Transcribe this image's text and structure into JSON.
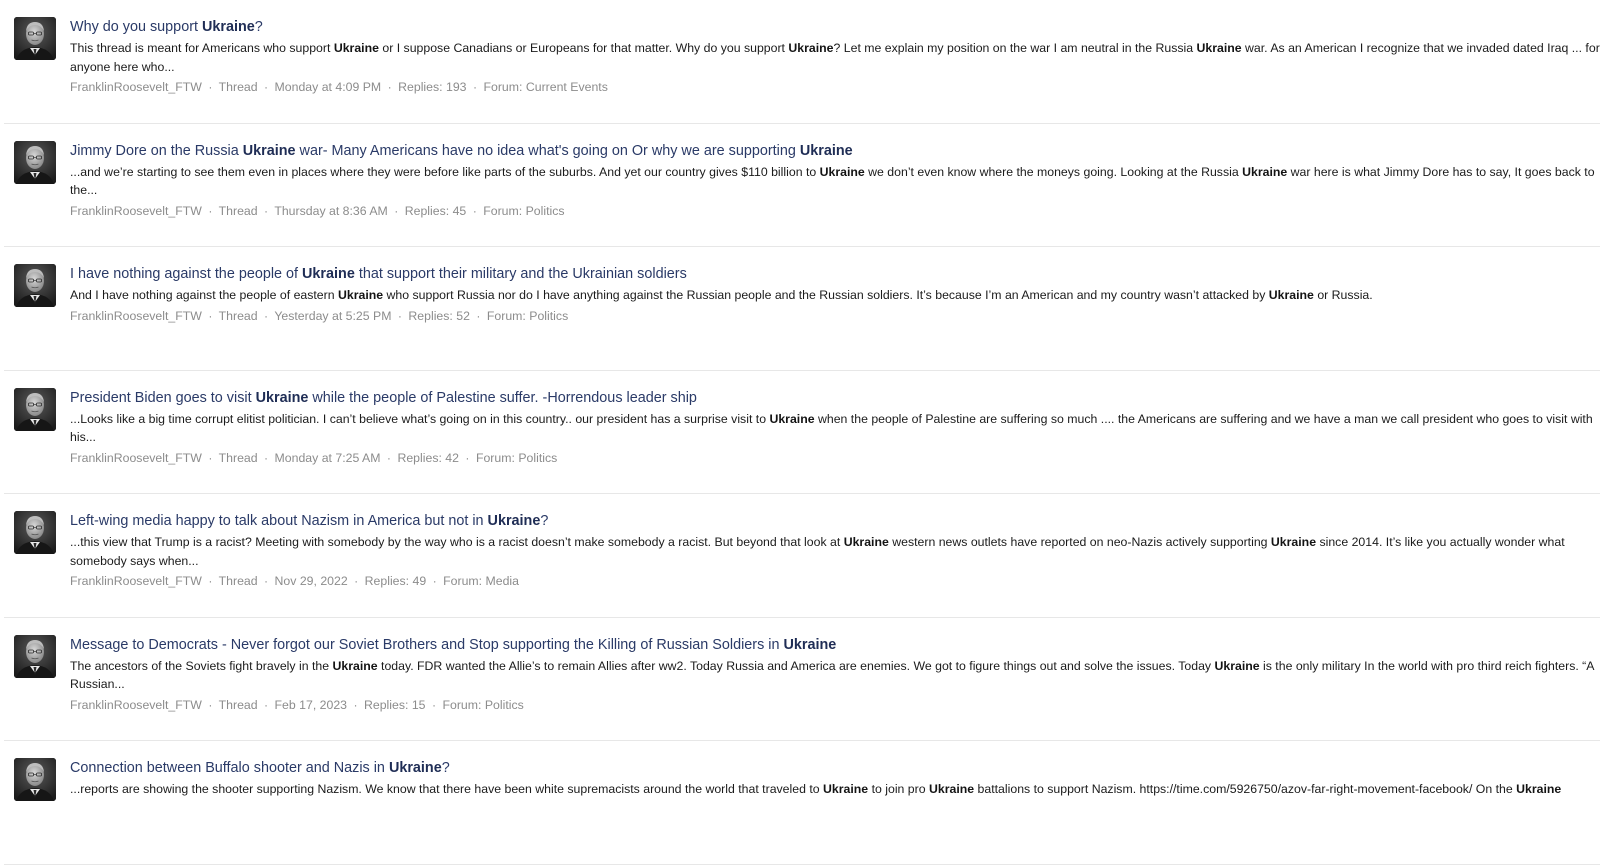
{
  "results": [
    {
      "title": [
        {
          "t": "Why do you support "
        },
        {
          "t": "Ukraine",
          "b": true
        },
        {
          "t": "?"
        }
      ],
      "snippet": [
        {
          "t": "This thread is meant for Americans who support "
        },
        {
          "t": "Ukraine",
          "b": true
        },
        {
          "t": " or I suppose Canadians or Europeans for that matter. Why do you support "
        },
        {
          "t": "Ukraine",
          "b": true
        },
        {
          "t": "? Let me explain my position on the war I am neutral in the Russia "
        },
        {
          "t": "Ukraine",
          "b": true
        },
        {
          "t": " war. As an American I recognize that we invaded dated Iraq ... for anyone here who..."
        }
      ],
      "author": "FranklinRoosevelt_FTW",
      "type": "Thread",
      "date": "Monday at 4:09 PM",
      "replies": "Replies: 193",
      "forum_label": "Forum:",
      "forum": "Current Events"
    },
    {
      "title": [
        {
          "t": "Jimmy Dore on the Russia "
        },
        {
          "t": "Ukraine",
          "b": true
        },
        {
          "t": " war- Many Americans have no idea what's going on Or why we are supporting "
        },
        {
          "t": "Ukraine",
          "b": true
        }
      ],
      "snippet": [
        {
          "t": "...and we’re starting to see them even in places where they were before like parts of the suburbs. And yet our country gives $110 billion to "
        },
        {
          "t": "Ukraine",
          "b": true
        },
        {
          "t": " we don’t even know where the moneys going. Looking at the Russia "
        },
        {
          "t": "Ukraine",
          "b": true
        },
        {
          "t": " war here is what Jimmy Dore has to say, It goes back to the..."
        }
      ],
      "author": "FranklinRoosevelt_FTW",
      "type": "Thread",
      "date": "Thursday at 8:36 AM",
      "replies": "Replies: 45",
      "forum_label": "Forum:",
      "forum": "Politics"
    },
    {
      "title": [
        {
          "t": "I have nothing against the people of "
        },
        {
          "t": "Ukraine",
          "b": true
        },
        {
          "t": " that support their military and the Ukrainian soldiers"
        }
      ],
      "snippet": [
        {
          "t": "And I have nothing against the people of eastern "
        },
        {
          "t": "Ukraine",
          "b": true
        },
        {
          "t": " who support Russia nor do I have anything against the Russian people and the Russian soldiers. It’s because I’m an American and my country wasn’t attacked by "
        },
        {
          "t": "Ukraine",
          "b": true
        },
        {
          "t": " or Russia."
        }
      ],
      "author": "FranklinRoosevelt_FTW",
      "type": "Thread",
      "date": "Yesterday at 5:25 PM",
      "replies": "Replies: 52",
      "forum_label": "Forum:",
      "forum": "Politics"
    },
    {
      "title": [
        {
          "t": "President Biden goes to visit "
        },
        {
          "t": "Ukraine",
          "b": true
        },
        {
          "t": " while the people of Palestine suffer. -Horrendous leader ship"
        }
      ],
      "snippet": [
        {
          "t": "...Looks like a big time corrupt elitist politician. I can’t believe what’s going on in this country.. our president has a surprise visit to "
        },
        {
          "t": "Ukraine",
          "b": true
        },
        {
          "t": " when the people of Palestine are suffering so much .... the Americans are suffering and we have a man we call president who goes to visit with his..."
        }
      ],
      "author": "FranklinRoosevelt_FTW",
      "type": "Thread",
      "date": "Monday at 7:25 AM",
      "replies": "Replies: 42",
      "forum_label": "Forum:",
      "forum": "Politics"
    },
    {
      "title": [
        {
          "t": "Left-wing media happy to talk about Nazism in America but not in "
        },
        {
          "t": "Ukraine",
          "b": true
        },
        {
          "t": "?"
        }
      ],
      "snippet": [
        {
          "t": "...this view that Trump is a racist? Meeting with somebody by the way who is a racist doesn’t make somebody a racist. But beyond that look at "
        },
        {
          "t": "Ukraine",
          "b": true
        },
        {
          "t": " western news outlets have reported on neo-Nazis actively supporting "
        },
        {
          "t": "Ukraine",
          "b": true
        },
        {
          "t": " since 2014. It’s like you actually wonder what somebody says when..."
        }
      ],
      "author": "FranklinRoosevelt_FTW",
      "type": "Thread",
      "date": "Nov 29, 2022",
      "replies": "Replies: 49",
      "forum_label": "Forum:",
      "forum": "Media"
    },
    {
      "title": [
        {
          "t": "Message to Democrats - Never forgot our Soviet Brothers and Stop supporting the Killing of Russian Soldiers in "
        },
        {
          "t": "Ukraine",
          "b": true
        }
      ],
      "snippet": [
        {
          "t": "The ancestors of the Soviets fight bravely in the "
        },
        {
          "t": "Ukraine",
          "b": true
        },
        {
          "t": " today. FDR wanted the Allie’s to remain Allies after ww2. Today Russia and America are enemies. We got to figure things out and solve the issues. Today "
        },
        {
          "t": "Ukraine",
          "b": true
        },
        {
          "t": " is the only military In the world with pro third reich fighters. “A Russian..."
        }
      ],
      "author": "FranklinRoosevelt_FTW",
      "type": "Thread",
      "date": "Feb 17, 2023",
      "replies": "Replies: 15",
      "forum_label": "Forum:",
      "forum": "Politics"
    },
    {
      "title": [
        {
          "t": "Connection between Buffalo shooter and Nazis in "
        },
        {
          "t": "Ukraine",
          "b": true
        },
        {
          "t": "?"
        }
      ],
      "snippet": [
        {
          "t": "...reports are showing the shooter supporting Nazism. We know that there have been white supremacists around the world that traveled to "
        },
        {
          "t": "Ukraine",
          "b": true
        },
        {
          "t": " to join pro "
        },
        {
          "t": "Ukraine",
          "b": true
        },
        {
          "t": " battalions to support Nazism. https://time.com/5926750/azov-far-right-movement-facebook/ On the "
        },
        {
          "t": "Ukraine",
          "b": true
        }
      ],
      "author": "",
      "type": "",
      "date": "",
      "replies": "",
      "forum_label": "",
      "forum": ""
    }
  ]
}
